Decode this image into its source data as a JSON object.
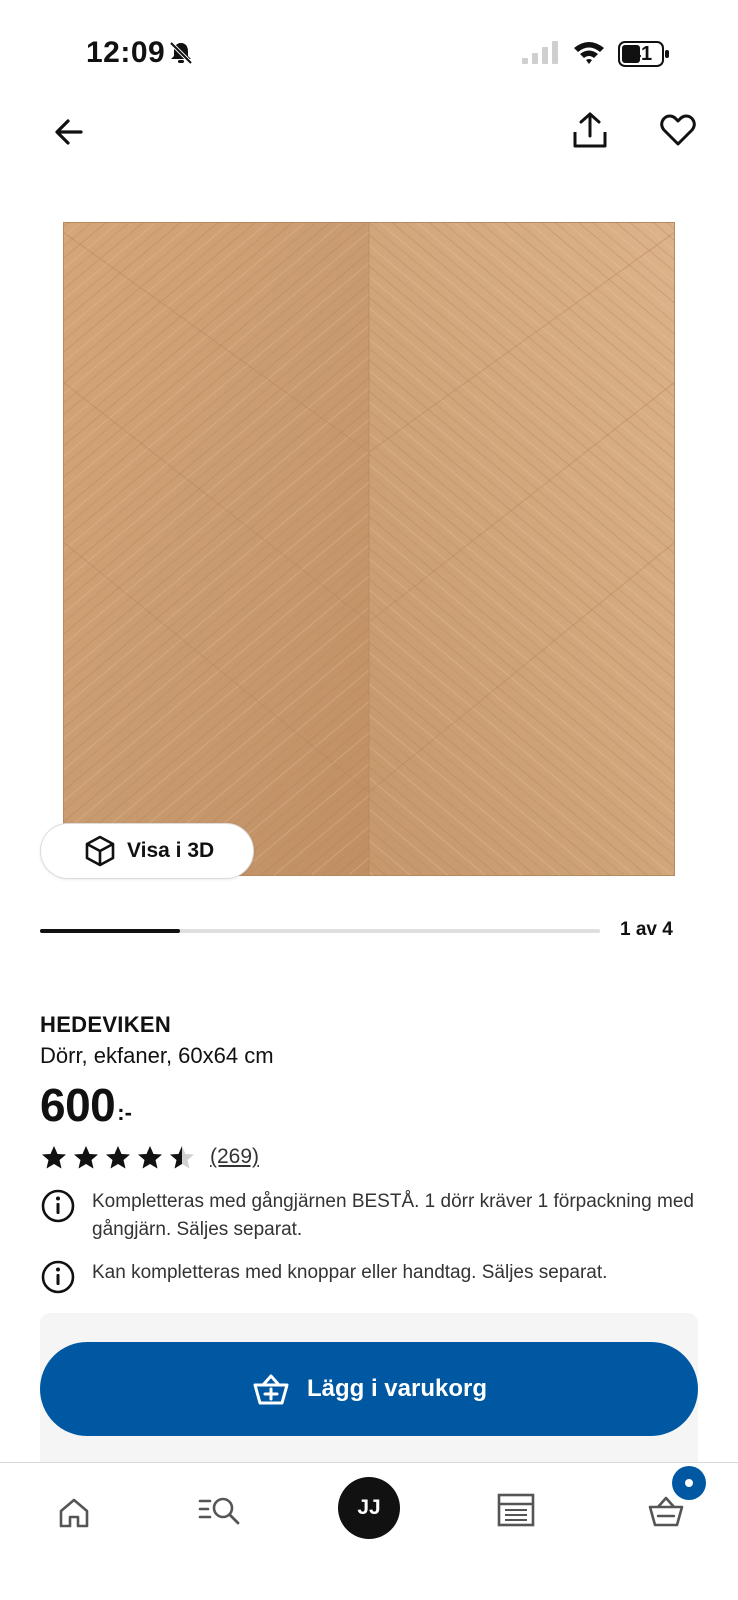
{
  "status_bar": {
    "time": "12:09",
    "battery": "41",
    "icons": [
      "bell-muted-icon",
      "signal-icon",
      "wifi-icon",
      "battery-icon"
    ]
  },
  "header": {
    "icons": [
      "back-arrow-icon",
      "share-icon",
      "heart-icon"
    ]
  },
  "gallery": {
    "view_3d_label": "Visa i 3D",
    "counter": "1 av 4",
    "current": 1,
    "total": 4,
    "progress": 0.25
  },
  "product": {
    "name": "HEDEVIKEN",
    "description": "Dörr, ekfaner, 60x64 cm",
    "price": "600",
    "price_suffix": ":-",
    "rating": 4.5,
    "rating_max": 5,
    "review_count": "(269)"
  },
  "info_notes": [
    "Kompletteras med gångjärnen BESTÅ. 1 dörr kräver 1 förpackning med gångjärn. Säljes separat.",
    "Kan kompletteras med knoppar eller handtag. Säljes separat."
  ],
  "cart": {
    "add_label": "Lägg i varukorg"
  },
  "bottom_nav": {
    "profile_initials": "JJ",
    "items": [
      "home-icon",
      "search-list-icon",
      "profile-avatar",
      "store-icon",
      "cart-icon"
    ]
  },
  "colors": {
    "primary": "#0058a3",
    "text": "#111111",
    "panel": "#f5f5f5",
    "wood_light": "#d6aa7c",
    "wood_dark": "#c1926a"
  }
}
